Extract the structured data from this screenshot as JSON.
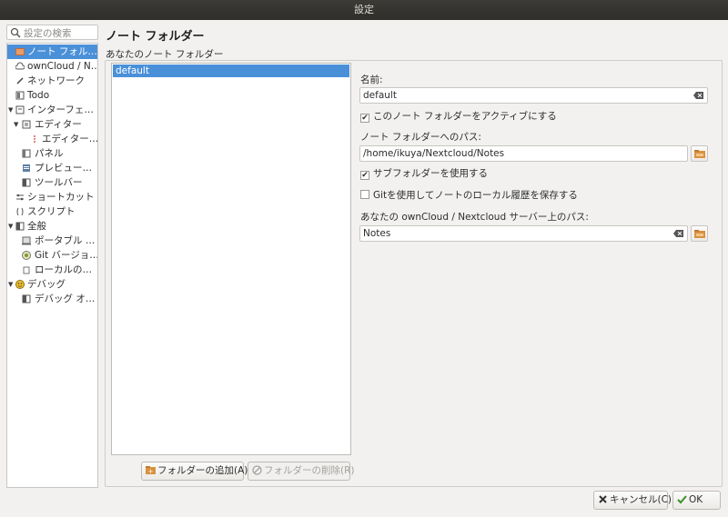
{
  "window": {
    "title": "設定"
  },
  "sidebar": {
    "search_placeholder": "設定の検索",
    "items": [
      {
        "label": "ノート フォル…",
        "icon": "notes-folder-icon"
      },
      {
        "label": "ownCloud / N…",
        "icon": "cloud-icon"
      },
      {
        "label": "ネットワーク",
        "icon": "network-icon"
      },
      {
        "label": "Todo",
        "icon": "todo-icon"
      },
      {
        "label": "インターフェ…",
        "icon": "interface-icon"
      },
      {
        "label": "エディター",
        "icon": "editor-icon"
      },
      {
        "label": "エディター…",
        "icon": "editor-fonts-icon"
      },
      {
        "label": "パネル",
        "icon": "panel-icon"
      },
      {
        "label": "プレビュー…",
        "icon": "preview-icon"
      },
      {
        "label": "ツールバー",
        "icon": "toolbar-icon"
      },
      {
        "label": "ショートカット",
        "icon": "shortcut-icon"
      },
      {
        "label": "スクリプト",
        "icon": "script-icon"
      },
      {
        "label": "全般",
        "icon": "general-icon"
      },
      {
        "label": "ポータブル …",
        "icon": "portable-icon"
      },
      {
        "label": "Git バージョ…",
        "icon": "git-icon"
      },
      {
        "label": "ローカルの…",
        "icon": "local-trash-icon"
      },
      {
        "label": "デバッグ",
        "icon": "debug-icon"
      },
      {
        "label": "デバッグ オ…",
        "icon": "debug-options-icon"
      }
    ]
  },
  "main": {
    "title": "ノート フォルダー",
    "group_label": "あなたのノート フォルダー",
    "folders": [
      "default"
    ],
    "add_button": "フォルダーの追加(A)",
    "remove_button": "フォルダーの削除(R)",
    "name_label": "名前:",
    "name_value": "default",
    "active_checkbox": "このノート フォルダーをアクティブにする",
    "path_label": "ノート フォルダーへのパス:",
    "path_value": "/home/ikuya/Nextcloud/Notes",
    "subfolders_checkbox": "サブフォルダーを使用する",
    "git_checkbox": "Gitを使用してノートのローカル履歴を保存する",
    "server_path_label": "あなたの ownCloud / Nextcloud サーバー上のパス:",
    "server_path_value": "Notes"
  },
  "footer": {
    "cancel": "キャンセル(C)",
    "ok": "OK"
  }
}
